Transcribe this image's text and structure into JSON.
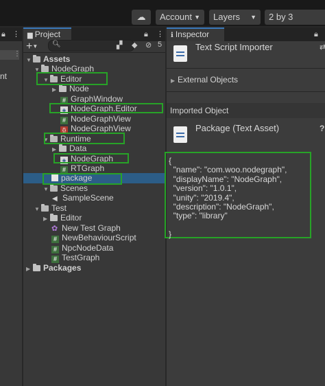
{
  "toolbar": {
    "cloud_icon": "cloud-icon",
    "account_label": "Account",
    "layers_label": "Layers",
    "layout_label": "2 by 3"
  },
  "left_panel": {
    "row_fragment": "nt"
  },
  "project": {
    "tab_label": "Project",
    "lock_icon": "lock-icon",
    "add_label": "+",
    "search_placeholder": "",
    "hidden_count": "5",
    "tree": [
      {
        "label": "Assets"
      },
      {
        "label": "NodeGraph"
      },
      {
        "label": "Editor"
      },
      {
        "label": "Node"
      },
      {
        "label": "GraphWindow"
      },
      {
        "label": "NodeGraph.Editor"
      },
      {
        "label": "NodeGraphView"
      },
      {
        "label": "NodeGraphView"
      },
      {
        "label": "Runtime"
      },
      {
        "label": "Data"
      },
      {
        "label": "NodeGraph"
      },
      {
        "label": "RTGraph"
      },
      {
        "label": "package"
      },
      {
        "label": "Scenes"
      },
      {
        "label": "SampleScene"
      },
      {
        "label": "Test"
      },
      {
        "label": "Editor"
      },
      {
        "label": "New Test Graph"
      },
      {
        "label": "NewBehaviourScript"
      },
      {
        "label": "NpcNodeData"
      },
      {
        "label": "TestGraph"
      },
      {
        "label": "Packages"
      }
    ]
  },
  "inspector": {
    "tab_label": "Inspector",
    "importer_title": "Text Script Importer",
    "external_objects_label": "External Objects",
    "imported_object_label": "Imported Object",
    "asset_title": "Package (Text Asset)",
    "help_label": "?",
    "json_lines": [
      "{",
      "  \"name\": \"com.woo.nodegraph\",",
      "  \"displayName\": \"NodeGraph\",",
      "  \"version\": \"1.0.1\",",
      "  \"unity\": \"2019.4\",",
      "  \"description\": \"NodeGraph\",",
      "  \"type\": \"library\"",
      "",
      "}"
    ]
  },
  "colors": {
    "selection": "#2c5d87",
    "highlight_box": "#27a327",
    "tab_accent": "#3a79bb"
  }
}
